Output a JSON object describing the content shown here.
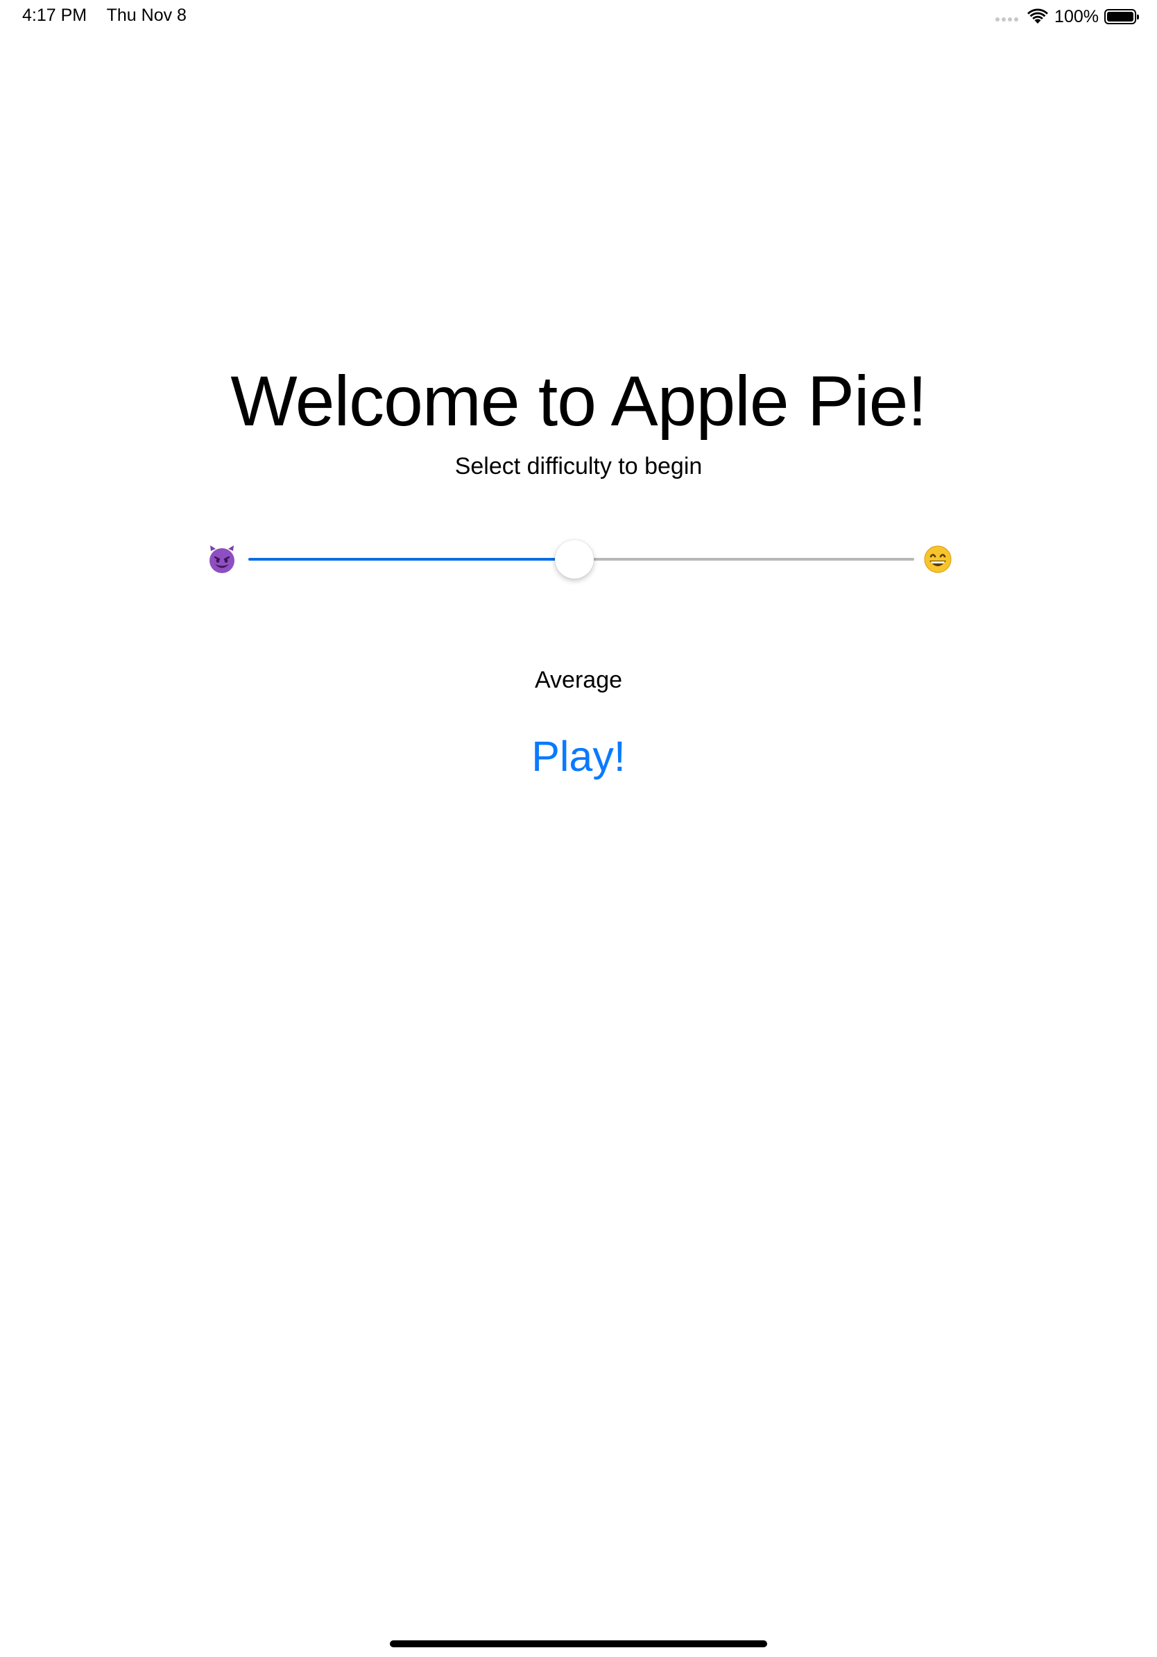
{
  "status_bar": {
    "time": "4:17 PM",
    "date": "Thu Nov 8",
    "battery_percent": "100%",
    "battery_level": 1.0,
    "wifi_icon": "wifi-icon",
    "cellular_icon": "cellular-dots-icon"
  },
  "main": {
    "title": "Welcome to Apple Pie!",
    "subtitle": "Select difficulty to begin",
    "slider": {
      "min_icon": "smiling-devil-emoji",
      "max_icon": "grinning-face-emoji",
      "value": 0.49,
      "track_fill_color": "#0a6fe0",
      "track_empty_color": "#b8b8b8"
    },
    "difficulty_label": "Average",
    "play_label": "Play!",
    "accent_color": "#0a7aff"
  }
}
